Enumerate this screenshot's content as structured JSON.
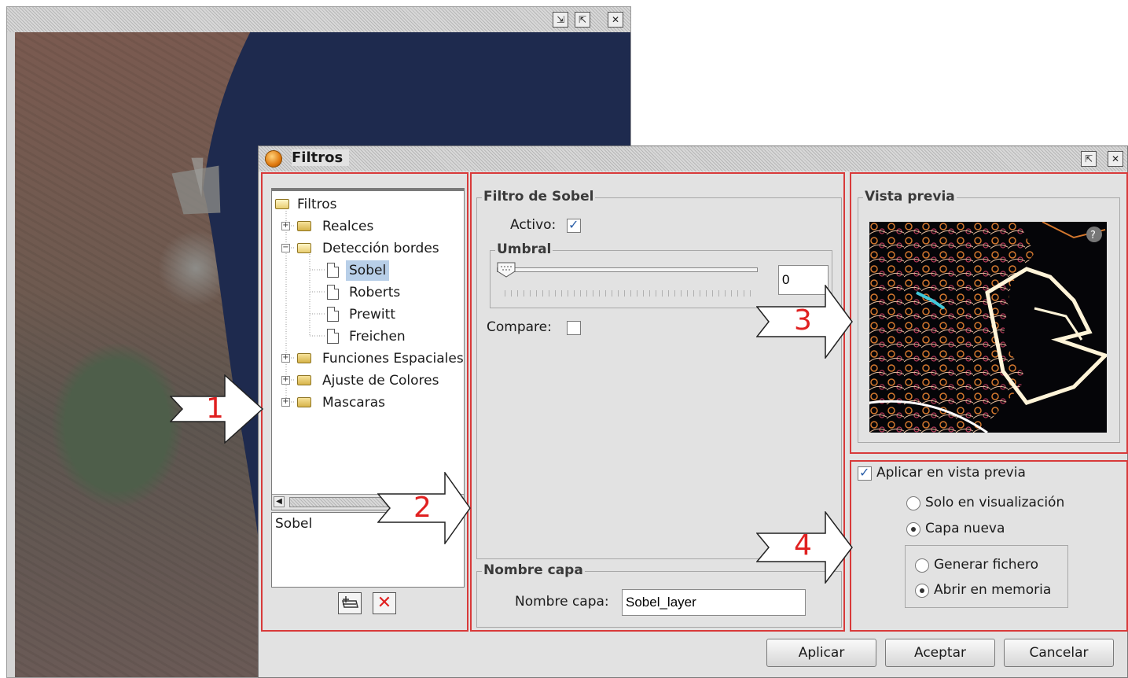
{
  "dialog": {
    "title": "Filtros",
    "buttons": {
      "apply": "Aplicar",
      "accept": "Aceptar",
      "cancel": "Cancelar"
    }
  },
  "filter_tree": {
    "root": "Filtros",
    "items": [
      {
        "label": "Realces",
        "kind": "folder",
        "expanded": false
      },
      {
        "label": "Detección bordes",
        "kind": "folder",
        "expanded": true
      },
      {
        "label": "Sobel",
        "kind": "file",
        "selected": true
      },
      {
        "label": "Roberts",
        "kind": "file"
      },
      {
        "label": "Prewitt",
        "kind": "file"
      },
      {
        "label": "Freichen",
        "kind": "file"
      },
      {
        "label": "Funciones Espaciales",
        "kind": "folder",
        "expanded": false
      },
      {
        "label": "Ajuste de Colores",
        "kind": "folder",
        "expanded": false
      },
      {
        "label": "Mascaras",
        "kind": "folder",
        "expanded": false
      }
    ],
    "selected_list": [
      "Sobel"
    ],
    "tools": {
      "add": "add-filter-icon",
      "remove": "delete-icon"
    }
  },
  "sobel": {
    "group_title": "Filtro de Sobel",
    "active_label": "Activo:",
    "active_checked": true,
    "threshold_title": "Umbral",
    "threshold_value": "0",
    "threshold_fraction": 0,
    "compare_label": "Compare:",
    "compare_checked": false
  },
  "layer_name": {
    "group_title": "Nombre capa",
    "label": "Nombre capa:",
    "value": "Sobel_layer"
  },
  "preview": {
    "group_title": "Vista previa",
    "help_icon": "help-icon"
  },
  "output": {
    "apply_preview_label": "Aplicar en vista previa",
    "apply_preview_checked": true,
    "only_view_label": "Solo en visualización",
    "new_layer_label": "Capa nueva",
    "selected_mode": "new_layer",
    "generate_file_label": "Generar fichero",
    "open_memory_label": "Abrir en memoria",
    "selected_target": "memory"
  },
  "callouts": [
    "1",
    "2",
    "3",
    "4"
  ],
  "colors": {
    "callout_border": "#d83a3a",
    "callout_number": "#e02020",
    "check_accent": "#2a5ea8",
    "selection": "#b8cfe8"
  }
}
